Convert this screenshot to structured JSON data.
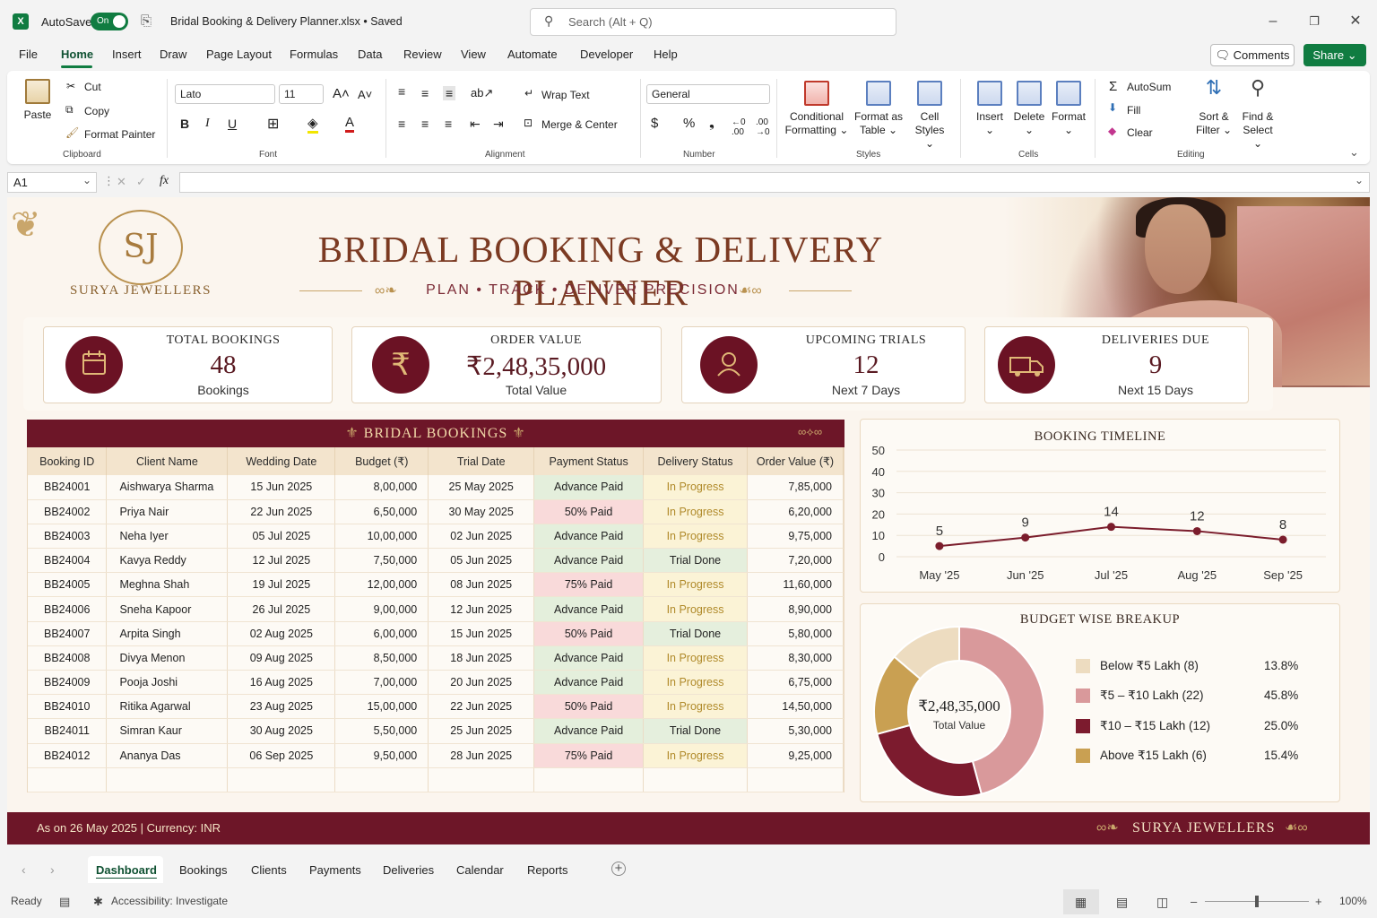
{
  "titlebar": {
    "autosave_label": "AutoSave",
    "autosave_state": "On",
    "filename": "Bridal Booking & Delivery Planner.xlsx • Saved",
    "search_placeholder": "Search (Alt + Q)"
  },
  "menu": {
    "items": [
      "File",
      "Home",
      "Insert",
      "Draw",
      "Page Layout",
      "Formulas",
      "Data",
      "Review",
      "View",
      "Automate",
      "Developer",
      "Help"
    ],
    "active": "Home",
    "comments": "Comments",
    "share": "Share"
  },
  "ribbon": {
    "clipboard": {
      "paste": "Paste",
      "cut": "Cut",
      "copy": "Copy",
      "format_painter": "Format Painter",
      "group": "Clipboard"
    },
    "font": {
      "name": "Lato",
      "size": "11",
      "group": "Font"
    },
    "alignment": {
      "wrap": "Wrap Text",
      "merge": "Merge & Center",
      "group": "Alignment"
    },
    "number": {
      "format": "General",
      "group": "Number"
    },
    "styles": {
      "conditional": "Conditional",
      "conditional2": "Formatting",
      "format_as": "Format as",
      "format_as2": "Table",
      "cell": "Cell",
      "cell2": "Styles",
      "group": "Styles"
    },
    "cells": {
      "insert": "Insert",
      "delete": "Delete",
      "format": "Format",
      "group": "Cells"
    },
    "editing": {
      "autosum": "AutoSum",
      "fill": "Fill",
      "clear": "Clear",
      "sort": "Sort &",
      "sort2": "Filter",
      "find": "Find &",
      "find2": "Select",
      "group": "Editing"
    }
  },
  "formula_bar": {
    "cell": "A1",
    "fx": "fx",
    "value": ""
  },
  "dashboard": {
    "logo_initials": "SJ",
    "brand": "SURYA JEWELLERS",
    "title": "BRIDAL BOOKING & DELIVERY PLANNER",
    "tagline": "PLAN  •  TRACK  •  DELIVER PRECISION",
    "kpis": [
      {
        "title": "TOTAL BOOKINGS",
        "value": "48",
        "sub": "Bookings",
        "icon": "calendar-icon"
      },
      {
        "title": "ORDER VALUE",
        "value": "₹2,48,35,000",
        "sub": "Total Value",
        "icon": "rupee-icon"
      },
      {
        "title": "UPCOMING TRIALS",
        "value": "12",
        "sub": "Next 7 Days",
        "icon": "person-icon"
      },
      {
        "title": "DELIVERIES DUE",
        "value": "9",
        "sub": "Next 15 Days",
        "icon": "truck-icon"
      }
    ],
    "table": {
      "title": "BRIDAL BOOKINGS",
      "columns": [
        "Booking ID",
        "Client Name",
        "Wedding Date",
        "Budget (₹)",
        "Trial Date",
        "Payment Status",
        "Delivery Status",
        "Order Value (₹)"
      ],
      "rows": [
        [
          "BB24001",
          "Aishwarya Sharma",
          "15 Jun 2025",
          "8,00,000",
          "25 May 2025",
          "Advance Paid",
          "In Progress",
          "7,85,000"
        ],
        [
          "BB24002",
          "Priya Nair",
          "22 Jun 2025",
          "6,50,000",
          "30 May 2025",
          "50% Paid",
          "In Progress",
          "6,20,000"
        ],
        [
          "BB24003",
          "Neha Iyer",
          "05 Jul 2025",
          "10,00,000",
          "02 Jun 2025",
          "Advance Paid",
          "In Progress",
          "9,75,000"
        ],
        [
          "BB24004",
          "Kavya Reddy",
          "12 Jul 2025",
          "7,50,000",
          "05 Jun 2025",
          "Advance Paid",
          "Trial Done",
          "7,20,000"
        ],
        [
          "BB24005",
          "Meghna Shah",
          "19 Jul 2025",
          "12,00,000",
          "08 Jun 2025",
          "75% Paid",
          "In Progress",
          "11,60,000"
        ],
        [
          "BB24006",
          "Sneha Kapoor",
          "26 Jul 2025",
          "9,00,000",
          "12 Jun 2025",
          "Advance Paid",
          "In Progress",
          "8,90,000"
        ],
        [
          "BB24007",
          "Arpita Singh",
          "02 Aug 2025",
          "6,00,000",
          "15 Jun 2025",
          "50% Paid",
          "Trial Done",
          "5,80,000"
        ],
        [
          "BB24008",
          "Divya Menon",
          "09 Aug 2025",
          "8,50,000",
          "18 Jun 2025",
          "Advance Paid",
          "In Progress",
          "8,30,000"
        ],
        [
          "BB24009",
          "Pooja Joshi",
          "16 Aug 2025",
          "7,00,000",
          "20 Jun 2025",
          "Advance Paid",
          "In Progress",
          "6,75,000"
        ],
        [
          "BB24010",
          "Ritika Agarwal",
          "23 Aug 2025",
          "15,00,000",
          "22 Jun 2025",
          "50% Paid",
          "In Progress",
          "14,50,000"
        ],
        [
          "BB24011",
          "Simran Kaur",
          "30 Aug 2025",
          "5,50,000",
          "25 Jun 2025",
          "Advance Paid",
          "Trial Done",
          "5,30,000"
        ],
        [
          "BB24012",
          "Ananya Das",
          "06 Sep 2025",
          "9,50,000",
          "28 Jun 2025",
          "75% Paid",
          "In Progress",
          "9,25,000"
        ]
      ]
    },
    "footer": {
      "left": "As on 26 May 2025   |   Currency: INR",
      "right": "SURYA JEWELLERS"
    }
  },
  "chart_data": [
    {
      "type": "line",
      "title": "BOOKING TIMELINE",
      "categories": [
        "May '25",
        "Jun '25",
        "Jul '25",
        "Aug '25",
        "Sep '25"
      ],
      "values": [
        5,
        9,
        14,
        12,
        8
      ],
      "ylim": [
        0,
        50
      ],
      "yticks": [
        0,
        10,
        20,
        30,
        40,
        50
      ],
      "grid": true,
      "color": "#7b1d2c"
    },
    {
      "type": "pie",
      "title": "BUDGET WISE BREAKUP",
      "center_value": "₹2,48,35,000",
      "center_label": "Total Value",
      "slices": [
        {
          "label": "Below ₹5 Lakh (8)",
          "pct_label": "13.8%",
          "value": 13.8,
          "color": "#eddcc0"
        },
        {
          "label": "₹5 – ₹10 Lakh (22)",
          "pct_label": "45.8%",
          "value": 45.8,
          "color": "#d9999b"
        },
        {
          "label": "₹10 – ₹15 Lakh (12)",
          "pct_label": "25.0%",
          "value": 25.0,
          "color": "#7c1b2e"
        },
        {
          "label": "Above ₹15 Lakh (6)",
          "pct_label": "15.4%",
          "value": 15.4,
          "color": "#c9a052"
        }
      ]
    }
  ],
  "sheet_tabs": [
    "Dashboard",
    "Bookings",
    "Clients",
    "Payments",
    "Deliveries",
    "Calendar",
    "Reports"
  ],
  "status": {
    "ready": "Ready",
    "accessibility": "Accessibility: Investigate",
    "zoom": "100%"
  }
}
